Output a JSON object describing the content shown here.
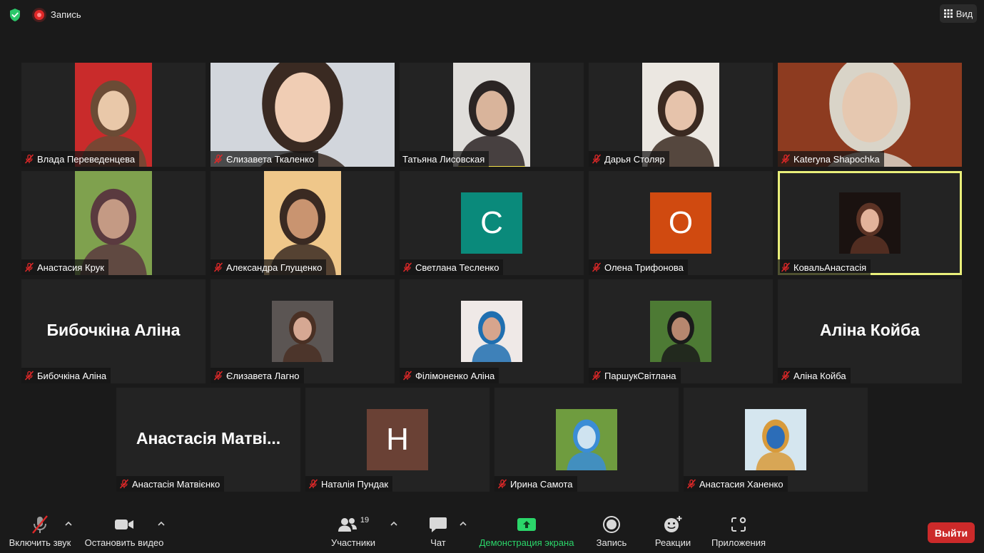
{
  "recording_label": "Запись",
  "view_label": "Вид",
  "rows": [
    [
      {
        "name": "Влада Переведенцева",
        "kind": "video",
        "muted": true,
        "palette": [
          "#c92b2b",
          "#e9c8a9",
          "#6b4b35"
        ]
      },
      {
        "name": "Єлизавета Ткаленко",
        "kind": "video-wide",
        "muted": true,
        "palette": [
          "#d2d6dc",
          "#f0cdb4",
          "#3a2a22"
        ]
      },
      {
        "name": "Татьяна Лисовская",
        "kind": "video",
        "muted": false,
        "speaking": true,
        "palette": [
          "#e0dedb",
          "#d9b49b",
          "#2b2524"
        ]
      },
      {
        "name": "Дарья Столяр",
        "kind": "video",
        "muted": true,
        "palette": [
          "#ebe7e1",
          "#e6c3ab",
          "#3b2a21"
        ]
      },
      {
        "name": "Kateryna Shapochka",
        "kind": "video-wide",
        "muted": true,
        "palette": [
          "#8d3b20",
          "#e6c8b0",
          "#d9d4c8"
        ]
      }
    ],
    [
      {
        "name": "Анастасия Крук",
        "kind": "video",
        "muted": true,
        "palette": [
          "#7fa14e",
          "#c49a84",
          "#5a3a3f"
        ]
      },
      {
        "name": "Александра Глущенко",
        "kind": "video",
        "muted": true,
        "palette": [
          "#efc78a",
          "#c99470",
          "#3a2a22"
        ]
      },
      {
        "name": "Светлана Тесленко",
        "kind": "letter",
        "letter": "С",
        "bg": "#0a8a7b",
        "muted": true
      },
      {
        "name": "Олена Трифонова",
        "kind": "letter",
        "letter": "О",
        "bg": "#d04a10",
        "muted": true
      },
      {
        "name": "КовальАнастасія",
        "kind": "photo",
        "muted": true,
        "active": true,
        "palette": [
          "#1a1210",
          "#e3b39b",
          "#5c3325"
        ]
      }
    ],
    [
      {
        "name": "Бибочкіна Аліна",
        "kind": "text",
        "muted": true
      },
      {
        "name": "Єлизавета Лагно",
        "kind": "photo",
        "muted": true,
        "palette": [
          "#5b5553",
          "#d6a893",
          "#4a3024"
        ]
      },
      {
        "name": "Філімоненко Аліна",
        "kind": "photo",
        "muted": true,
        "palette": [
          "#efe9e7",
          "#d7a58d",
          "#1f6fb0"
        ]
      },
      {
        "name": "ПаршукСвітлана",
        "kind": "photo",
        "muted": true,
        "palette": [
          "#4d7a34",
          "#b7876f",
          "#1b1b1b"
        ]
      },
      {
        "name": "Аліна Койба",
        "kind": "text",
        "muted": true
      }
    ],
    [
      {
        "name": "Анастасія Матвієнко",
        "kind": "text",
        "display": "Анастасія Матві...",
        "muted": true
      },
      {
        "name": "Наталія Пундак",
        "kind": "letter",
        "letter": "Н",
        "bg": "#6a4135",
        "muted": true
      },
      {
        "name": "Ирина Самота",
        "kind": "photo",
        "muted": true,
        "palette": [
          "#6f9c3f",
          "#cfe3f0",
          "#3b8dd6"
        ]
      },
      {
        "name": "Анастасия Ханенко",
        "kind": "photo",
        "muted": true,
        "palette": [
          "#d5e6ef",
          "#2c6db8",
          "#d89a3a"
        ]
      }
    ]
  ],
  "toolbar": {
    "unmute_label": "Включить звук",
    "stop_video_label": "Остановить видео",
    "participants_label": "Участники",
    "participants_count": "19",
    "chat_label": "Чат",
    "share_label": "Демонстрация экрана",
    "record_label": "Запись",
    "reactions_label": "Реакции",
    "apps_label": "Приложения",
    "leave_label": "Выйти"
  },
  "colors": {
    "background": "#1a1a1a",
    "tile": "#232323",
    "active_border": "#e9ef7a",
    "share_green": "#2bd66a",
    "leave_red": "#cc2a2a",
    "muted_red": "#e02828"
  }
}
